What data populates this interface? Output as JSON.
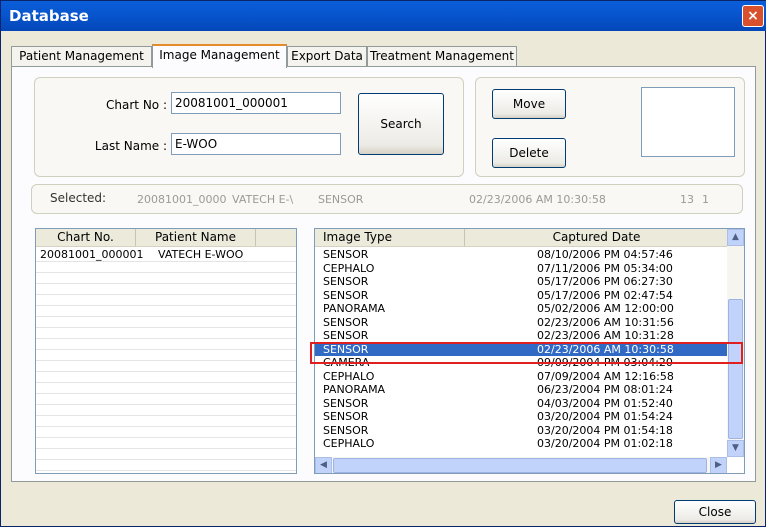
{
  "window": {
    "title": "Database",
    "close_glyph": "×"
  },
  "tabs": [
    {
      "label": "Patient Management"
    },
    {
      "label": "Image Management"
    },
    {
      "label": "Export Data"
    },
    {
      "label": "Treatment Management"
    }
  ],
  "search": {
    "chart_no_label": "Chart No :",
    "chart_no_value": "20081001_000001",
    "last_name_label": "Last Name :",
    "last_name_value": "E-WOO",
    "search_button": "Search"
  },
  "actions": {
    "move_button": "Move",
    "delete_button": "Delete"
  },
  "selected": {
    "label": "Selected:",
    "chart": "20081001_0000",
    "name": "VATECH E-\\",
    "type": "SENSOR",
    "date": "02/23/2006 AM 10:30:58",
    "num1": "13",
    "num2": "1"
  },
  "patients": {
    "headers": [
      "Chart No.",
      "Patient Name"
    ],
    "rows": [
      {
        "chart": "20081001_000001",
        "name": "VATECH E-WOO"
      }
    ]
  },
  "images": {
    "headers": [
      "Image Type",
      "Captured Date"
    ],
    "rows": [
      {
        "type": "SENSOR",
        "date": "08/10/2006 PM 04:57:46"
      },
      {
        "type": "CEPHALO",
        "date": "07/11/2006 PM 05:34:00"
      },
      {
        "type": "SENSOR",
        "date": "05/17/2006 PM 06:27:30"
      },
      {
        "type": "SENSOR",
        "date": "05/17/2006 PM 02:47:54"
      },
      {
        "type": "PANORAMA",
        "date": "05/02/2006 AM 12:00:00"
      },
      {
        "type": "SENSOR",
        "date": "02/23/2006 AM 10:31:56"
      },
      {
        "type": "SENSOR",
        "date": "02/23/2006 AM 10:31:28"
      },
      {
        "type": "SENSOR",
        "date": "02/23/2006 AM 10:30:58"
      },
      {
        "type": "CAMERA",
        "date": "09/09/2004 PM 03:04:20"
      },
      {
        "type": "CEPHALO",
        "date": "07/09/2004 AM 12:16:58"
      },
      {
        "type": "PANORAMA",
        "date": "06/23/2004 PM 08:01:24"
      },
      {
        "type": "SENSOR",
        "date": "04/03/2004 PM 01:52:40"
      },
      {
        "type": "SENSOR",
        "date": "03/20/2004 PM 01:54:24"
      },
      {
        "type": "SENSOR",
        "date": "03/20/2004 PM 01:54:18"
      },
      {
        "type": "CEPHALO",
        "date": "03/20/2004 PM 01:02:18"
      }
    ],
    "selected_index": 7
  },
  "footer": {
    "close_button": "Close"
  },
  "colors": {
    "selection": "#316ac5",
    "highlight_box": "#e02020",
    "active_tab_accent": "#e68b2c"
  }
}
